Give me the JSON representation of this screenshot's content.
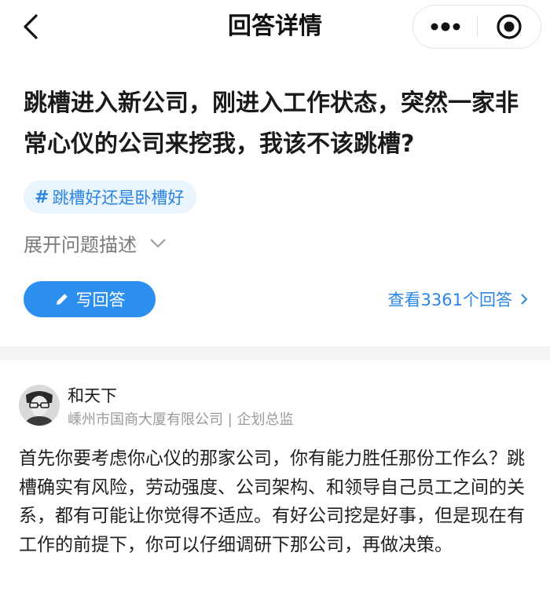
{
  "nav": {
    "title": "回答详情",
    "back_icon": "chevron-left-icon",
    "more_icon": "more-dots-icon",
    "close_icon": "target-circle-icon"
  },
  "question": {
    "title": "跳槽进入新公司，刚进入工作状态，突然一家非常心仪的公司来挖我，我该不该跳槽?",
    "topic_hash": "#",
    "topic": "跳槽好还是卧槽好",
    "expand_label": "展开问题描述"
  },
  "actions": {
    "write_answer": "写回答",
    "view_all": "查看3361个回答",
    "accent_color": "#2c8ff0"
  },
  "answer": {
    "author_name": "和天下",
    "author_info": "嵊州市国商大厦有限公司 | 企划总监",
    "body": "首先你要考虑你心仪的那家公司，你有能力胜任那份工作么？跳槽确实有风险，劳动强度、公司架构、和领导自己员工之间的关系，都有可能让你觉得不适应。有好公司挖是好事，但是现在有工作的前提下，你可以仔细调研下那公司，再做决策。"
  }
}
